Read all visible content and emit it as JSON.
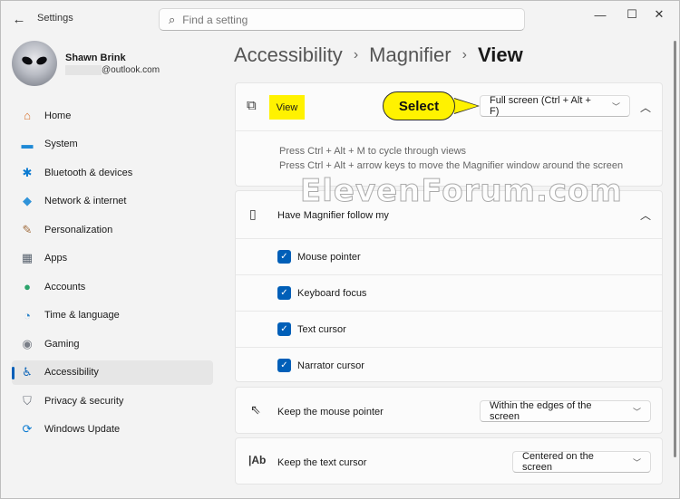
{
  "window": {
    "title": "Settings"
  },
  "search": {
    "placeholder": "Find a setting"
  },
  "user": {
    "name": "Shawn Brink",
    "email": "@outlook.com"
  },
  "sidebar": {
    "items": [
      {
        "label": "Home",
        "icon": "home-icon",
        "glyph": "⌂",
        "color": "#d9702b"
      },
      {
        "label": "System",
        "icon": "system-icon",
        "glyph": "▬",
        "color": "#1f8ad6"
      },
      {
        "label": "Bluetooth & devices",
        "icon": "bluetooth-icon",
        "glyph": "✱",
        "color": "#0a7ad1"
      },
      {
        "label": "Network & internet",
        "icon": "network-icon",
        "glyph": "◆",
        "color": "#2f93d9"
      },
      {
        "label": "Personalization",
        "icon": "personalization-icon",
        "glyph": "✎",
        "color": "#a06b3c"
      },
      {
        "label": "Apps",
        "icon": "apps-icon",
        "glyph": "▦",
        "color": "#5a6470"
      },
      {
        "label": "Accounts",
        "icon": "accounts-icon",
        "glyph": "●",
        "color": "#2ba36b"
      },
      {
        "label": "Time & language",
        "icon": "time-language-icon",
        "glyph": "◔",
        "color": "#2a83c9"
      },
      {
        "label": "Gaming",
        "icon": "gaming-icon",
        "glyph": "◉",
        "color": "#7a7f88"
      },
      {
        "label": "Accessibility",
        "icon": "accessibility-icon",
        "glyph": "♿",
        "color": "#0a63b8",
        "selected": true
      },
      {
        "label": "Privacy & security",
        "icon": "shield-icon",
        "glyph": "⛉",
        "color": "#6d737c"
      },
      {
        "label": "Windows Update",
        "icon": "windows-update-icon",
        "glyph": "⟳",
        "color": "#0a7ad1"
      }
    ]
  },
  "breadcrumb": {
    "level1": "Accessibility",
    "level2": "Magnifier",
    "current": "View"
  },
  "view_card": {
    "label": "View",
    "selected_value": "Full screen (Ctrl + Alt + F)",
    "hint1": "Press Ctrl + Alt + M to cycle through views",
    "hint2": "Press Ctrl + Alt + arrow keys to move the Magnifier window around the screen"
  },
  "callout": {
    "text": "Select"
  },
  "follow_card": {
    "label": "Have Magnifier follow my",
    "options": [
      "Mouse pointer",
      "Keyboard focus",
      "Text cursor",
      "Narrator cursor"
    ]
  },
  "mouse_card": {
    "label": "Keep the mouse pointer",
    "selected_value": "Within the edges of the screen"
  },
  "text_card": {
    "label": "Keep the text cursor",
    "selected_value": "Centered on the screen"
  },
  "watermark": {
    "text": "ElevenForum.com"
  },
  "colors": {
    "accent": "#005fb8",
    "highlight": "#fff200"
  }
}
